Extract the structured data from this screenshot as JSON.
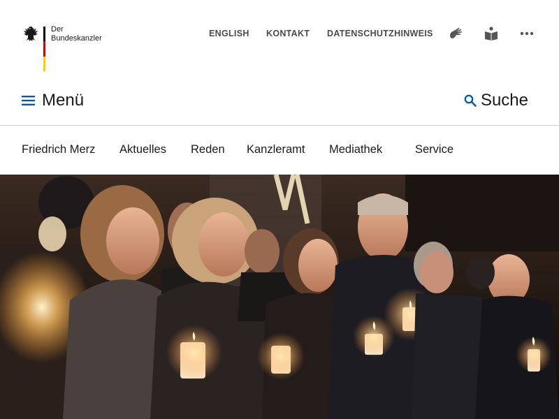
{
  "brand": {
    "line1": "Der",
    "line2": "Bundeskanzler",
    "flag_colors": [
      "#000000",
      "#dd0000",
      "#ffcc00"
    ]
  },
  "meta_nav": {
    "english": "ENGLISH",
    "kontakt": "KONTAKT",
    "datenschutz": "DATENSCHUTZHINWEIS",
    "icons": [
      "sign-language-icon",
      "easy-read-icon",
      "more-icon"
    ]
  },
  "menubar": {
    "menu_label": "Menü",
    "search_label": "Suche",
    "accent_color": "#005ca8"
  },
  "main_nav": {
    "items": [
      "Friedrich Merz",
      "Aktuelles",
      "Reden",
      "Kanzleramt",
      "Mediathek",
      "Service"
    ]
  },
  "hero": {
    "description_icon": "candlelight-vigil-photo"
  }
}
